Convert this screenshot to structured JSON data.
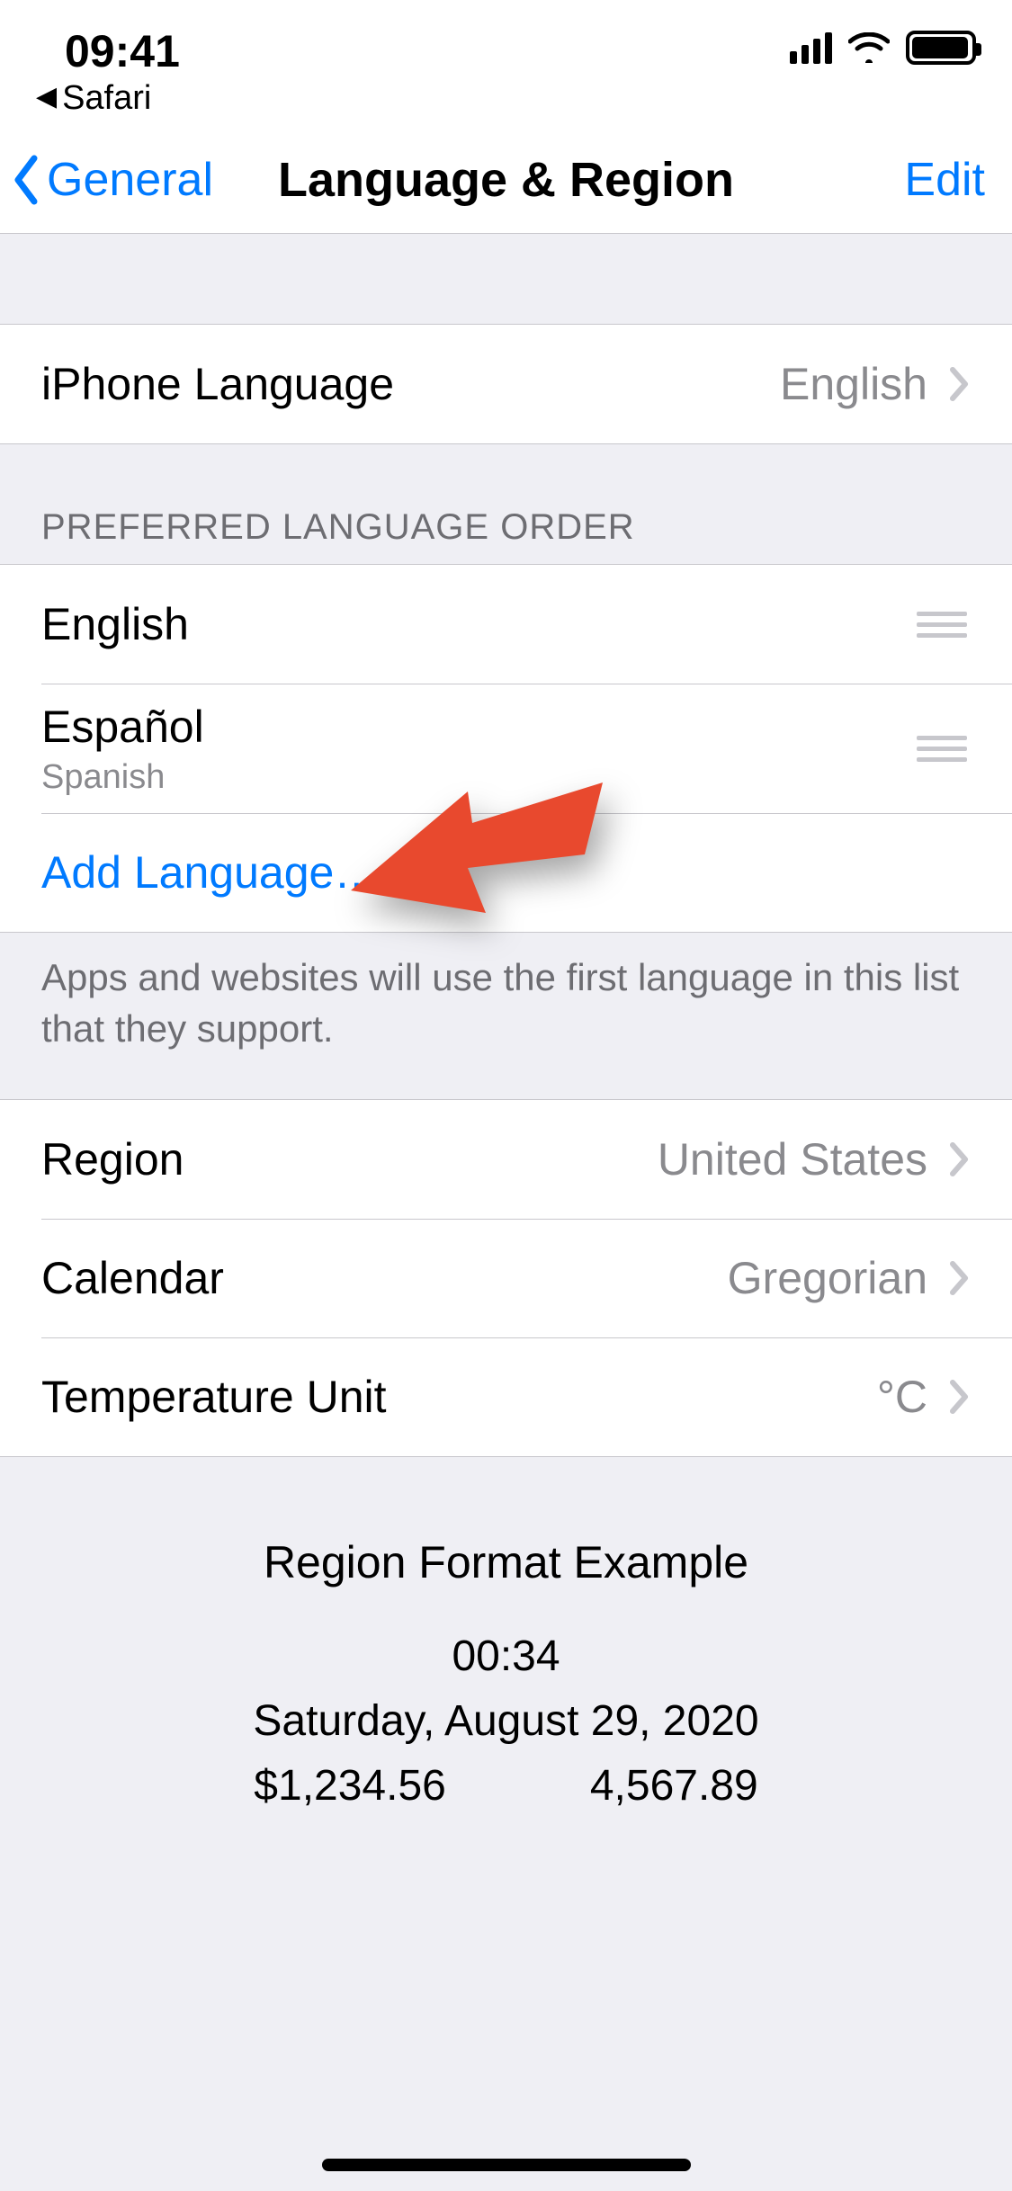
{
  "status": {
    "time": "09:41",
    "back_app": "Safari"
  },
  "nav": {
    "back_label": "General",
    "title": "Language & Region",
    "edit_label": "Edit"
  },
  "iphone_language": {
    "label": "iPhone Language",
    "value": "English"
  },
  "preferred": {
    "header": "Preferred Language Order",
    "items": [
      {
        "title": "English",
        "subtitle": ""
      },
      {
        "title": "Español",
        "subtitle": "Spanish"
      }
    ],
    "add_label": "Add Language…",
    "footer": "Apps and websites will use the first language in this list that they support."
  },
  "region_settings": {
    "region": {
      "label": "Region",
      "value": "United States"
    },
    "calendar": {
      "label": "Calendar",
      "value": "Gregorian"
    },
    "temperature": {
      "label": "Temperature Unit",
      "value": "°C"
    }
  },
  "example": {
    "heading": "Region Format Example",
    "time": "00:34",
    "date": "Saturday, August 29, 2020",
    "currency": "$1,234.56",
    "number": "4,567.89"
  }
}
